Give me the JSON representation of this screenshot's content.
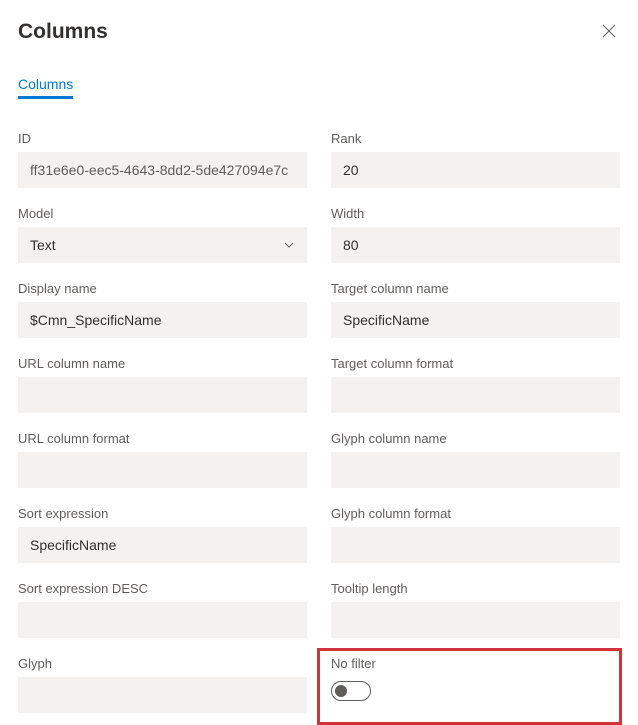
{
  "header": {
    "title": "Columns"
  },
  "tabs": {
    "columns": "Columns"
  },
  "fields": {
    "id": {
      "label": "ID",
      "value": "ff31e6e0-eec5-4643-8dd2-5de427094e7c"
    },
    "rank": {
      "label": "Rank",
      "value": "20"
    },
    "model": {
      "label": "Model",
      "value": "Text"
    },
    "width": {
      "label": "Width",
      "value": "80"
    },
    "display_name": {
      "label": "Display name",
      "value": "$Cmn_SpecificName"
    },
    "target_column_name": {
      "label": "Target column name",
      "value": "SpecificName"
    },
    "url_column_name": {
      "label": "URL column name",
      "value": ""
    },
    "target_column_format": {
      "label": "Target column format",
      "value": ""
    },
    "url_column_format": {
      "label": "URL column format",
      "value": ""
    },
    "glyph_column_name": {
      "label": "Glyph column name",
      "value": ""
    },
    "sort_expression": {
      "label": "Sort expression",
      "value": "SpecificName"
    },
    "glyph_column_format": {
      "label": "Glyph column format",
      "value": ""
    },
    "sort_expression_desc": {
      "label": "Sort expression DESC",
      "value": ""
    },
    "tooltip_length": {
      "label": "Tooltip length",
      "value": ""
    },
    "glyph": {
      "label": "Glyph",
      "value": ""
    },
    "no_filter": {
      "label": "No filter",
      "value": false
    }
  }
}
